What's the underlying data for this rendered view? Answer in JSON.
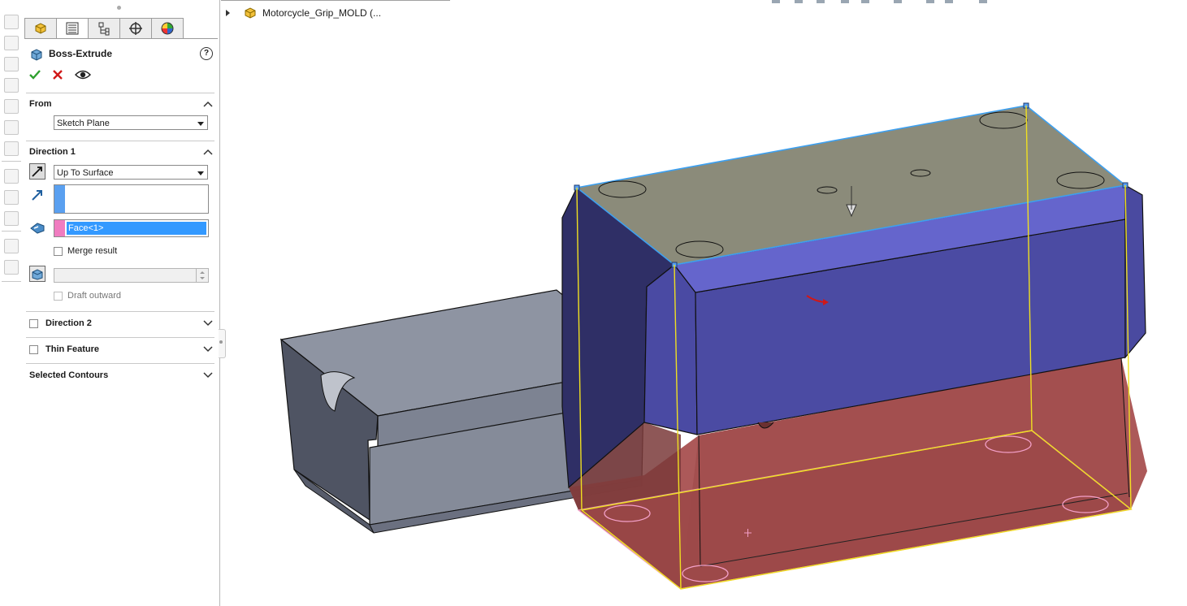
{
  "tree": {
    "label": "Motorcycle_Grip_MOLD  (..."
  },
  "panel": {
    "title": "Boss-Extrude",
    "help_glyph": "?",
    "from": {
      "label": "From",
      "value": "Sketch Plane"
    },
    "direction1": {
      "label": "Direction 1",
      "end_condition": "Up To Surface",
      "face_item": "Face<1>",
      "merge_label": "Merge result",
      "draft_label": "Draft outward",
      "draft_value": ""
    },
    "direction2": {
      "label": "Direction 2"
    },
    "thin_feature": {
      "label": "Thin Feature"
    },
    "selected_contours": {
      "label": "Selected Contours"
    }
  },
  "colors": {
    "accent_blue": "#3399ff",
    "ok_green": "#2ea02e",
    "cancel_red": "#d01818",
    "direction_swatch": "#5aa0f0",
    "face_swatch": "#f07cc0"
  },
  "icons": [
    "part-icon",
    "feature-manager-icon",
    "property-manager-icon",
    "configuration-manager-icon",
    "dimxpert-icon",
    "display-manager-icon",
    "boss-extrude-icon",
    "help-icon",
    "ok-check-icon",
    "cancel-x-icon",
    "preview-eye-icon",
    "reverse-direction-icon",
    "direction-vector-icon",
    "face-select-icon",
    "draft-icon",
    "chevron-up-icon",
    "chevron-down-icon"
  ]
}
